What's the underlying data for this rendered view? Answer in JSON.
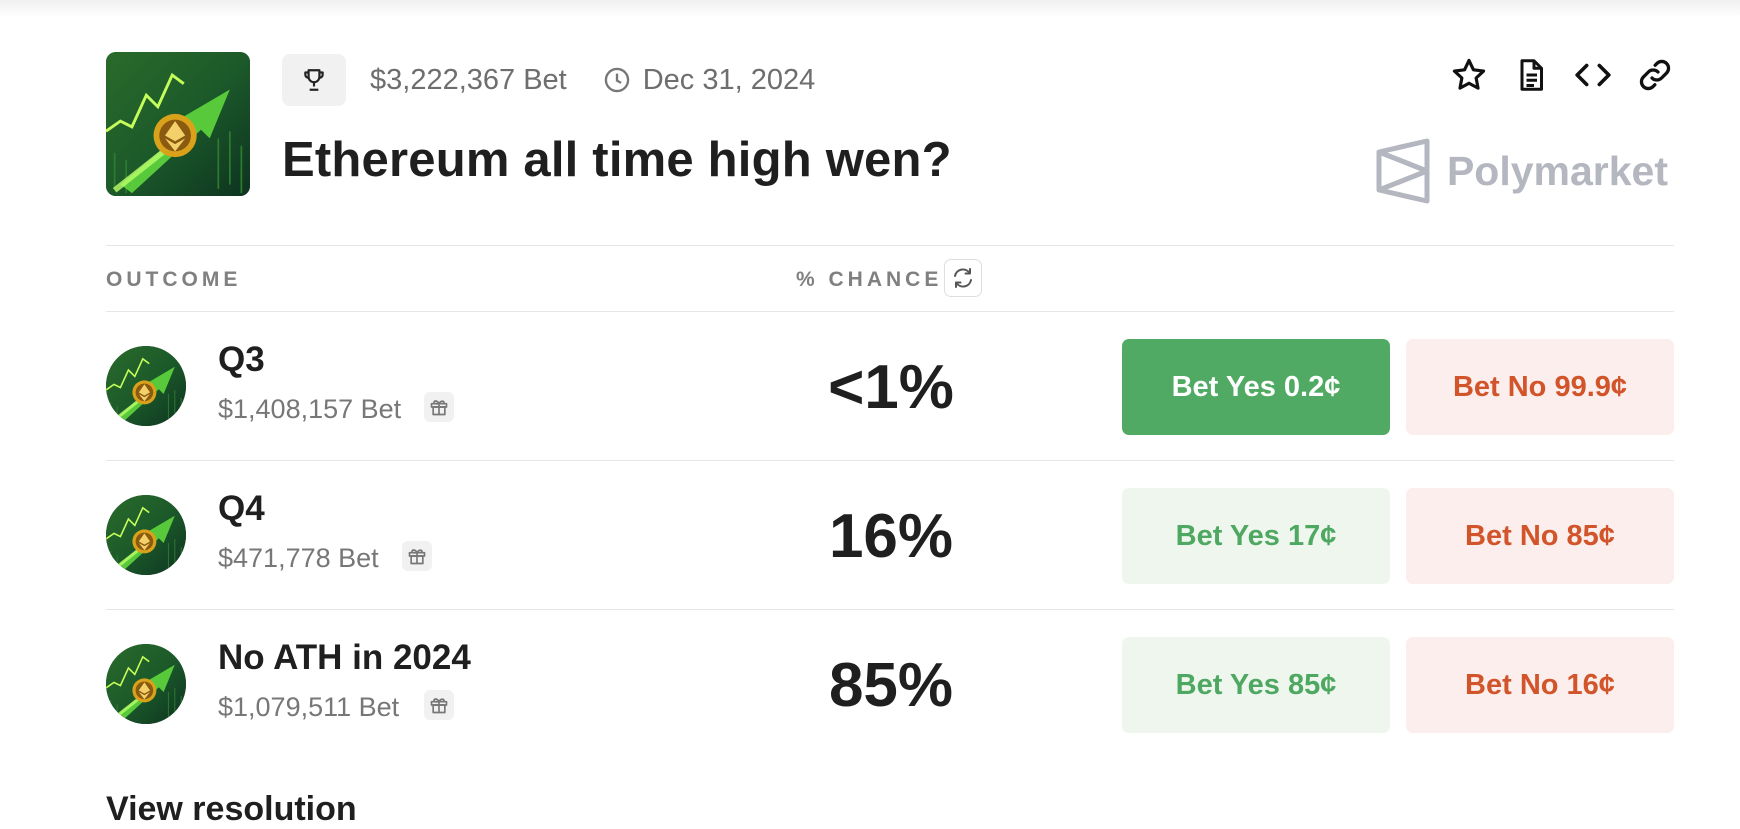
{
  "market": {
    "volume": "$3,222,367 Bet",
    "end_date": "Dec 31, 2024",
    "title": "Ethereum all time high wen?",
    "brand": "Polymarket"
  },
  "icons": {
    "market_category": "trophy-icon",
    "end_date": "clock-icon",
    "actions": [
      "star-icon",
      "document-icon",
      "code-icon",
      "link-icon"
    ],
    "refresh": "refresh-icon",
    "reward": "gift-icon"
  },
  "table": {
    "outcome_header": "OUTCOME",
    "chance_header": "% CHANCE"
  },
  "outcomes": [
    {
      "name": "Q3",
      "volume": "$1,408,157 Bet",
      "chance": "<1%",
      "yes_label": "Bet Yes 0.2¢",
      "no_label": "Bet No 99.9¢",
      "yes_selected": true
    },
    {
      "name": "Q4",
      "volume": "$471,778 Bet",
      "chance": "16%",
      "yes_label": "Bet Yes 17¢",
      "no_label": "Bet No 85¢",
      "yes_selected": false
    },
    {
      "name": "No ATH in 2024",
      "volume": "$1,079,511 Bet",
      "chance": "85%",
      "yes_label": "Bet Yes 85¢",
      "no_label": "Bet No 16¢",
      "yes_selected": false
    }
  ],
  "footer": {
    "view_more": "View resolution"
  },
  "colors": {
    "yes_active_bg": "#50aa63",
    "yes_bg": "#eef6ee",
    "yes_text": "#4fa862",
    "no_bg": "#fbeeec",
    "no_text": "#d2542a",
    "brand_gray": "#b4b7c0"
  }
}
